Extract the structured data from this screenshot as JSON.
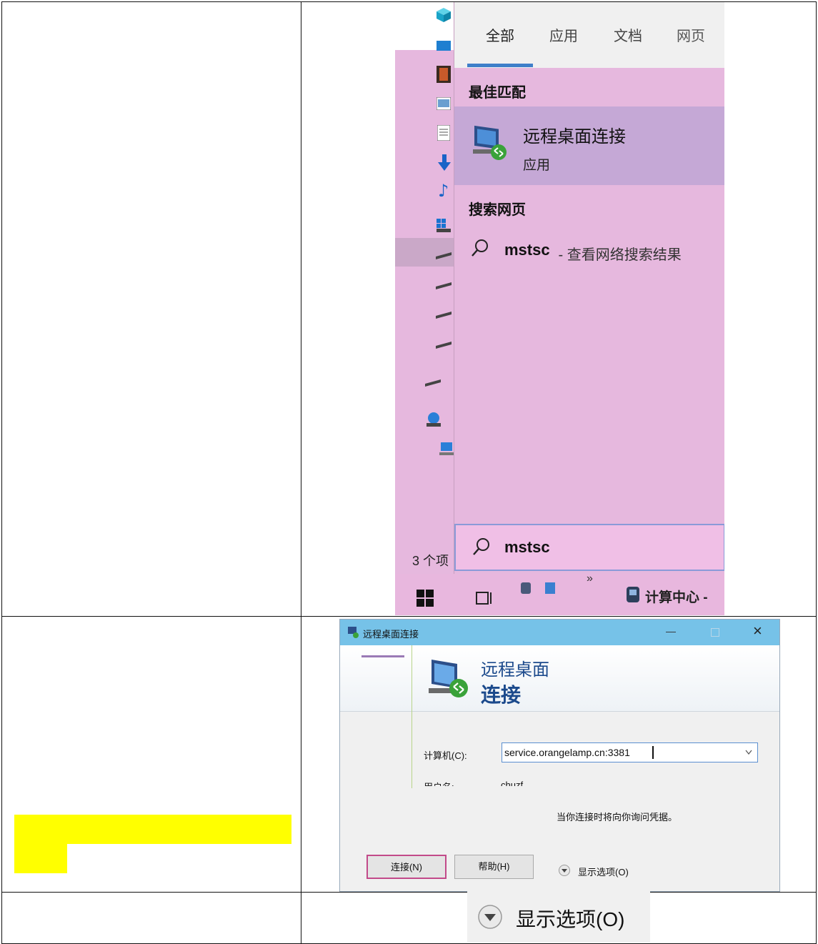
{
  "search": {
    "tabs": [
      "全部",
      "应用",
      "文档",
      "网页"
    ],
    "best_match_heading": "最佳匹配",
    "best_match_title": "远程桌面连接",
    "best_match_type": "应用",
    "web_heading": "搜索网页",
    "web_query": "mstsc",
    "web_suffix": " - 查看网络搜索结果",
    "box_value": "mstsc"
  },
  "explorer": {
    "status": "3 个项"
  },
  "taskbar": {
    "overflow_glyph": "»",
    "app_label": "计算中心 -"
  },
  "dialog": {
    "title": "远程桌面连接",
    "banner_line1": "远程桌面",
    "banner_line2": "连接",
    "computer_label": "计算机(C):",
    "computer_value": "service.orangelamp.cn:3381",
    "user_label": "用户名:",
    "user_value": "chuzf",
    "credentials_note": "当你连接时将向你询问凭据。",
    "connect_button": "连接(N)",
    "help_button": "帮助(H)",
    "options_link": "显示选项(O)",
    "close_glyph": "×",
    "minimize_glyph": "—"
  },
  "zoom_option": {
    "label": "显示选项(O)"
  },
  "colors": {
    "highlight": "#ffff00",
    "search_bg": "#e6b8de",
    "selected_bg": "#c5a8d6",
    "titlebar": "#76c2e8",
    "accent": "#3f7fc9"
  }
}
